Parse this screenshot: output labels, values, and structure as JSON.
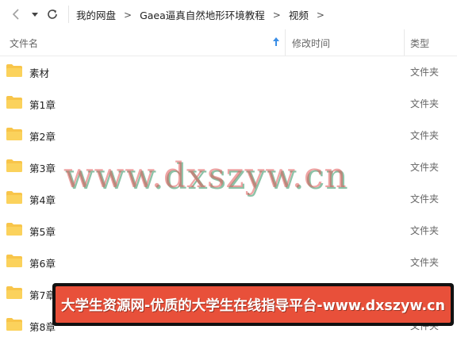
{
  "toolbar": {
    "back_icon": "chevron-left-icon",
    "dropdown_icon": "caret-down-icon",
    "refresh_icon": "refresh-icon"
  },
  "breadcrumb": {
    "items": [
      "我的网盘",
      "Gaea逼真自然地形环境教程",
      "视频"
    ],
    "separator": ">"
  },
  "header": {
    "name": "文件名",
    "date": "修改时间",
    "type": "类型",
    "sort_icon": "arrow-up-icon"
  },
  "files": [
    {
      "name": "素材",
      "type": "文件夹"
    },
    {
      "name": "第1章",
      "type": "文件夹"
    },
    {
      "name": "第2章",
      "type": "文件夹"
    },
    {
      "name": "第3章",
      "type": "文件夹"
    },
    {
      "name": "第4章",
      "type": "文件夹"
    },
    {
      "name": "第5章",
      "type": "文件夹"
    },
    {
      "name": "第6章",
      "type": "文件夹"
    },
    {
      "name": "第7章",
      "type": "文件夹"
    },
    {
      "name": "第8章",
      "type": "文件夹"
    }
  ],
  "overlay": {
    "watermark": "www.dxszyw.cn",
    "banner": "大学生资源网-优质的大学生在线指导平台-www.dxszyw.cn"
  },
  "colors": {
    "folder": "#f8c54a",
    "sort_arrow": "#3a8ee6",
    "banner_bg": "#e8503a"
  }
}
